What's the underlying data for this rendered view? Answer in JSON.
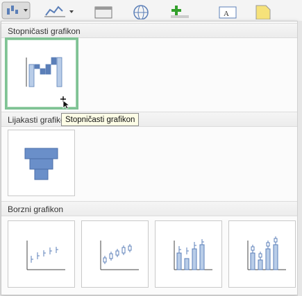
{
  "toolbar": {
    "buttons": [
      {
        "name": "chart-type-dropdown-button",
        "icon": "stock-chart-icon"
      },
      {
        "name": "sparkline-button",
        "icon": "sparkline-icon"
      },
      {
        "name": "table-button",
        "icon": "table-icon"
      },
      {
        "name": "web-button",
        "icon": "globe-icon"
      },
      {
        "name": "add-button",
        "icon": "plus-icon"
      },
      {
        "name": "textbox-button",
        "icon": "textbox-icon"
      },
      {
        "name": "note-button",
        "icon": "note-icon"
      }
    ]
  },
  "gallery": {
    "sections": [
      {
        "title": "Stopničasti grafikon"
      },
      {
        "title": "Lijakasti grafikon"
      },
      {
        "title": "Borzni grafikon"
      }
    ],
    "tooltip": "Stopničasti grafikon"
  },
  "colors": {
    "accent_blue": "#5b7fb8",
    "light_blue": "#b9cde8",
    "selected_border": "#7fc394"
  }
}
